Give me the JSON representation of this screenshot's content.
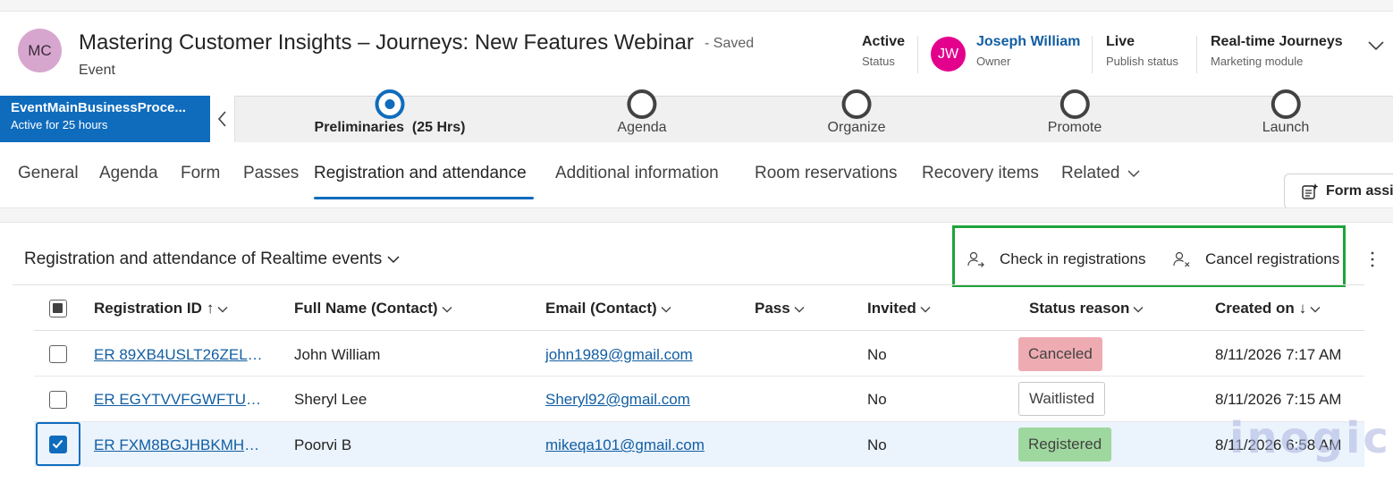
{
  "header": {
    "avatar_initials": "MC",
    "title": "Mastering Customer Insights – Journeys: New Features Webinar",
    "saved": "- Saved",
    "entity": "Event",
    "fields": [
      {
        "value": "Active",
        "label": "Status"
      },
      {
        "initials": "JW",
        "value": "Joseph William",
        "label": "Owner"
      },
      {
        "value": "Live",
        "label": "Publish status"
      },
      {
        "value": "Real-time Journeys",
        "label": "Marketing module"
      }
    ]
  },
  "bpf": {
    "active_name": "EventMainBusinessProce...",
    "active_duration": "Active for 25 hours",
    "stages": [
      {
        "label": "Preliminaries",
        "duration": "(25 Hrs)"
      },
      {
        "label": "Agenda"
      },
      {
        "label": "Organize"
      },
      {
        "label": "Promote"
      },
      {
        "label": "Launch"
      }
    ]
  },
  "tabs": [
    "General",
    "Agenda",
    "Form",
    "Passes",
    "Registration and attendance",
    "Additional information",
    "Room reservations",
    "Recovery items",
    "Related"
  ],
  "form_assist": "Form assis",
  "subgrid": {
    "title": "Registration and attendance of Realtime events",
    "commands": {
      "check_in": "Check in registrations",
      "cancel": "Cancel registrations"
    },
    "columns": [
      {
        "label": "Registration ID",
        "sort": "↑"
      },
      {
        "label": "Full Name (Contact)"
      },
      {
        "label": "Email (Contact)"
      },
      {
        "label": "Pass"
      },
      {
        "label": "Invited"
      },
      {
        "label": "Status reason"
      },
      {
        "label": "Created on",
        "sort": "↓"
      }
    ],
    "rows": [
      {
        "id": "ER 89XB4USLT26ZEL8AL...",
        "name": "John William",
        "email": "john1989@gmail.com",
        "pass": "",
        "invited": "No",
        "status": "Canceled",
        "created": "8/11/2026 7:17 AM"
      },
      {
        "id": "ER EGYTVVFGWFTUEHG...",
        "name": "Sheryl Lee",
        "email": "Sheryl92@gmail.com",
        "pass": "",
        "invited": "No",
        "status": "Waitlisted",
        "created": "8/11/2026 7:15 AM"
      },
      {
        "id": "ER FXM8BGJHBKMHERL...",
        "name": "Poorvi B",
        "email": "mikeqa101@gmail.com",
        "pass": "",
        "invited": "No",
        "status": "Registered",
        "created": "8/11/2026 6:58 AM"
      }
    ]
  },
  "watermark": "inogic",
  "colors": {
    "brand_blue": "#0f6cbd",
    "highlight_green": "#1fa33a",
    "canceled": "#eeacb2",
    "registered": "#9fd89f",
    "owner_avatar": "#e3008c"
  }
}
